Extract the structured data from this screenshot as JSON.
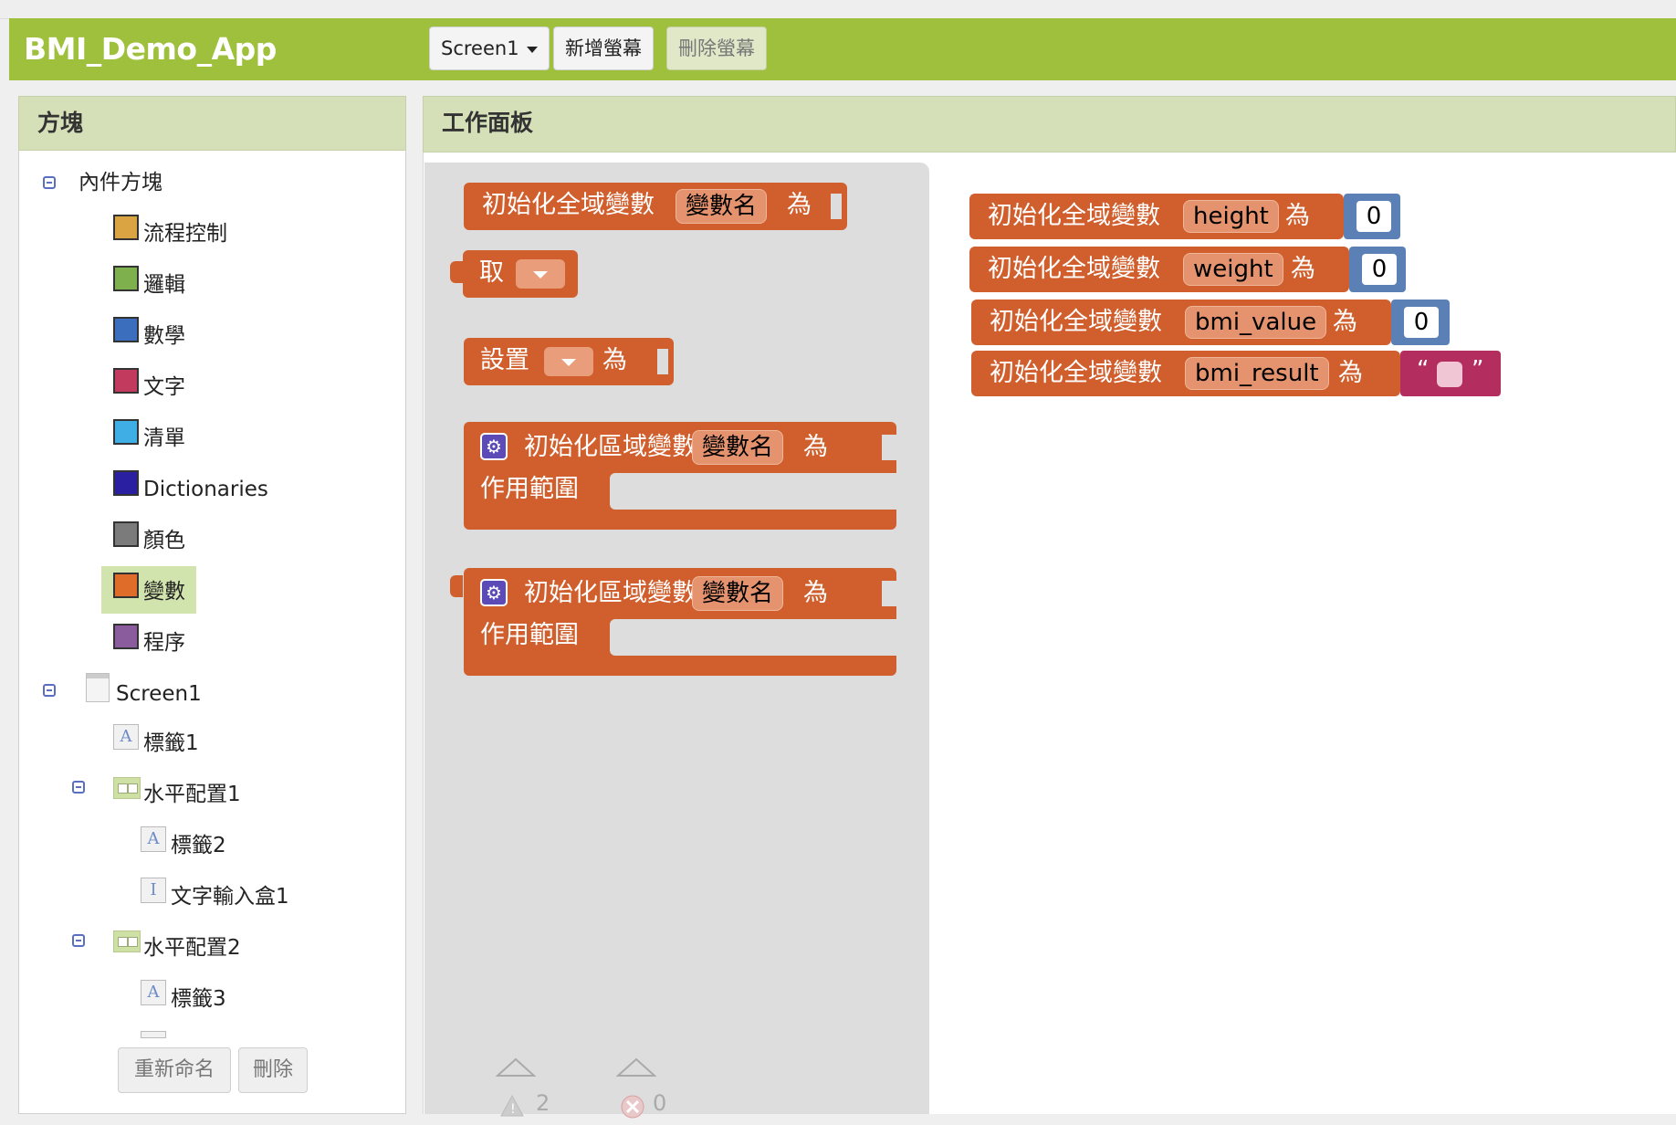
{
  "app_title": "BMI_Demo_App",
  "toolbar": {
    "screen_select": "Screen1",
    "add_screen": "新增螢幕",
    "remove_screen": "刪除螢幕"
  },
  "left_panel": {
    "title": "方塊",
    "builtin_group": "內件方塊",
    "categories": [
      {
        "label": "流程控制",
        "color": "#d9a441"
      },
      {
        "label": "邏輯",
        "color": "#7fb04e"
      },
      {
        "label": "數學",
        "color": "#3b6fbd"
      },
      {
        "label": "文字",
        "color": "#c23b5e"
      },
      {
        "label": "清單",
        "color": "#3eaee4"
      },
      {
        "label": "Dictionaries",
        "color": "#2a1fa0"
      },
      {
        "label": "顏色",
        "color": "#7b7b7b"
      },
      {
        "label": "變數",
        "color": "#e06c2a"
      },
      {
        "label": "程序",
        "color": "#8a5c9e"
      }
    ],
    "screen": "Screen1",
    "components": [
      "標籤1",
      "水平配置1",
      "標籤2",
      "文字輸入盒1",
      "水平配置2",
      "標籤3"
    ],
    "rename_button": "重新命名",
    "delete_button": "刪除"
  },
  "workspace": {
    "title": "工作面板",
    "flyout": {
      "init_global": {
        "label": "初始化全域變數",
        "name": "變數名",
        "as": "為"
      },
      "get": {
        "label": "取"
      },
      "set": {
        "label": "設置",
        "as": "為"
      },
      "init_local_1": {
        "label": "初始化區域變數",
        "name": "變數名",
        "as": "為",
        "scope": "作用範圍"
      },
      "init_local_2": {
        "label": "初始化區域變數",
        "name": "變數名",
        "as": "為",
        "scope": "作用範圍"
      }
    },
    "globals": [
      {
        "label": "初始化全域變數",
        "name": "height",
        "as": "為",
        "value": "0"
      },
      {
        "label": "初始化全域變數",
        "name": "weight",
        "as": "為",
        "value": "0"
      },
      {
        "label": "初始化全域變數",
        "name": "bmi_value",
        "as": "為",
        "value": "0"
      },
      {
        "label": "初始化全域變數",
        "name": "bmi_result",
        "as": "為",
        "open_quote": "“",
        "close_quote": "”"
      }
    ],
    "warnings_count": "2",
    "errors_count": "0"
  }
}
